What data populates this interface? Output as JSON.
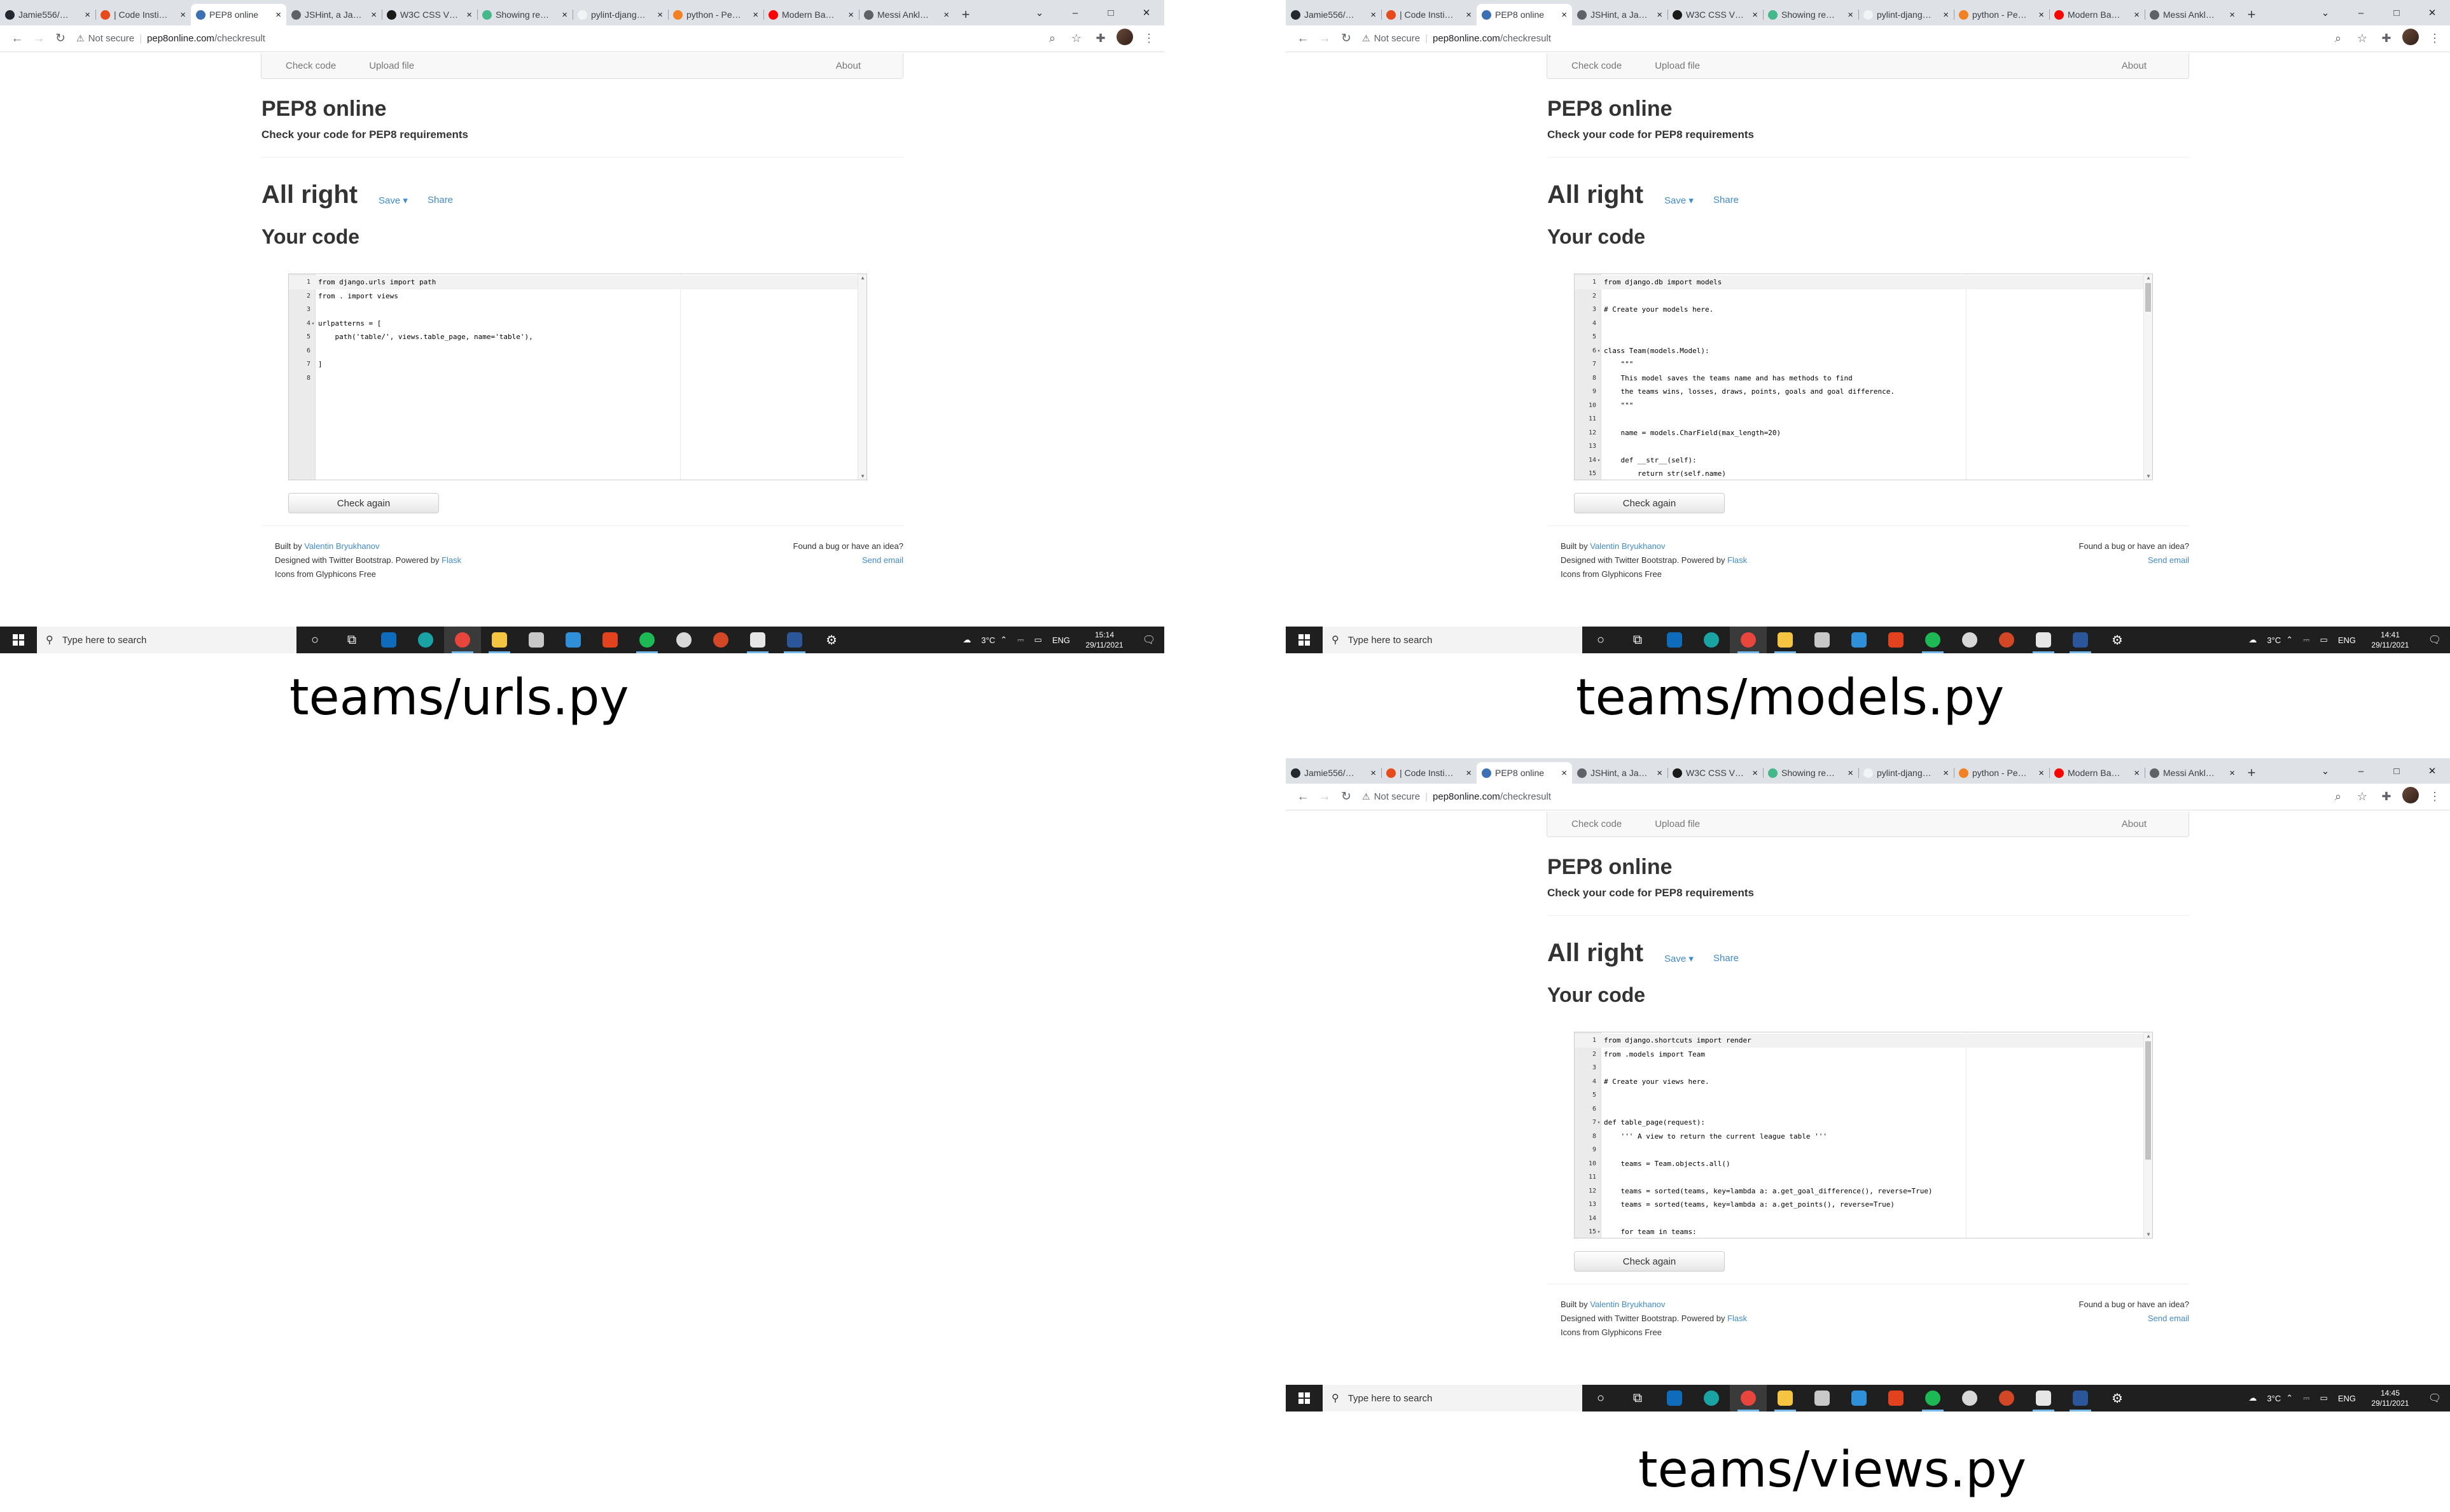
{
  "captions": [
    "teams/urls.py",
    "teams/models.py",
    "teams/views.py"
  ],
  "tabs": [
    {
      "title": "Jamie556/…",
      "icon": "github-icon",
      "color": "#24292f",
      "active": false
    },
    {
      "title": "| Code Insti…",
      "icon": "code-institute-icon",
      "color": "#e84a1c",
      "active": false
    },
    {
      "title": "PEP8 online",
      "icon": "pep8-icon",
      "color": "#3d6fb5",
      "active": true
    },
    {
      "title": "JSHint, a Ja…",
      "icon": "globe-icon",
      "color": "#5f6368",
      "active": false
    },
    {
      "title": "W3C CSS V…",
      "icon": "w3c-icon",
      "color": "#1a1a1a",
      "active": false
    },
    {
      "title": "Showing re…",
      "icon": "django-icon",
      "color": "#44b78b",
      "active": false
    },
    {
      "title": "pylint-djang…",
      "icon": "blank-page-icon",
      "color": "#f1f3f4",
      "active": false
    },
    {
      "title": "python - Pe…",
      "icon": "stackoverflow-icon",
      "color": "#f48024",
      "active": false
    },
    {
      "title": "Modern Ba…",
      "icon": "youtube-icon",
      "color": "#ff0000",
      "active": false
    },
    {
      "title": "Messi Ankl…",
      "icon": "globe-icon",
      "color": "#5f6368",
      "active": false
    }
  ],
  "window_controls": {
    "chevron": "⌄",
    "minimize": "–",
    "maximize": "□",
    "close": "✕"
  },
  "address": {
    "warning": "Not secure",
    "host": "pep8online.com",
    "path": "/checkresult"
  },
  "site": {
    "nav_check": "Check code",
    "nav_upload": "Upload file",
    "nav_about": "About",
    "title": "PEP8 online",
    "subtitle": "Check your code for PEP8 requirements",
    "result": "All right",
    "save": "Save ▾",
    "share": "Share",
    "your_code": "Your code",
    "check_again": "Check again",
    "footer": {
      "built_by": "Built by ",
      "author": "Valentin Bryukhanov",
      "designed": "Designed with Twitter Bootstrap. Powered by ",
      "flask": "Flask",
      "icons": "Icons from Glyphicons Free",
      "bug": "Found a bug or have an idea?",
      "send": "Send email"
    }
  },
  "shots": [
    {
      "time": "15:14",
      "date": "29/11/2021",
      "scroll_thumb_fraction": 0,
      "lines": [
        "from django.urls import path",
        "from . import views",
        "",
        "urlpatterns = [",
        "    path('table/', views.table_page, name='table'),",
        "",
        "]",
        ""
      ],
      "fold_lines": [
        4
      ]
    },
    {
      "time": "14:41",
      "date": "29/11/2021",
      "scroll_thumb_fraction": 0.15,
      "lines": [
        "from django.db import models",
        "",
        "# Create your models here.",
        "",
        "",
        "class Team(models.Model):",
        "    \"\"\"",
        "    This model saves the teams name and has methods to find",
        "    the teams wins, losses, draws, points, goals and goal difference.",
        "    \"\"\"",
        "",
        "    name = models.CharField(max_length=20)",
        "",
        "    def __str__(self):",
        "        return str(self.name)"
      ],
      "fold_lines": [
        6,
        14
      ]
    },
    {
      "time": "14:45",
      "date": "29/11/2021",
      "scroll_thumb_fraction": 0.62,
      "lines": [
        "from django.shortcuts import render",
        "from .models import Team",
        "",
        "# Create your views here.",
        "",
        "",
        "def table_page(request):",
        "    ''' A view to return the current league table '''",
        "",
        "    teams = Team.objects.all()",
        "",
        "    teams = sorted(teams, key=lambda a: a.get_goal_difference(), reverse=True)",
        "    teams = sorted(teams, key=lambda a: a.get_points(), reverse=True)",
        "",
        "    for team in teams:"
      ],
      "fold_lines": [
        7,
        15
      ]
    }
  ],
  "taskbar": {
    "search_placeholder": "Type here to search",
    "weather": "3°C",
    "lang": "ENG",
    "apps": [
      {
        "name": "cortana-icon",
        "glyph": "○",
        "color": ""
      },
      {
        "name": "task-view-icon",
        "glyph": "⧉",
        "color": ""
      },
      {
        "name": "mail-icon",
        "glyph": "",
        "color": "#0f6cbd"
      },
      {
        "name": "edge-icon",
        "glyph": "",
        "color": "#1aa3a3"
      },
      {
        "name": "chrome-icon",
        "glyph": "",
        "color": "#e8453c"
      },
      {
        "name": "file-explorer-icon",
        "glyph": "",
        "color": "#f5c542"
      },
      {
        "name": "calculator-icon",
        "glyph": "",
        "color": "#c8c8c8"
      },
      {
        "name": "internet-explorer-icon",
        "glyph": "",
        "color": "#2f8fd8"
      },
      {
        "name": "office-icon",
        "glyph": "",
        "color": "#e2431e"
      },
      {
        "name": "spotify-icon",
        "glyph": "",
        "color": "#1db954"
      },
      {
        "name": "chrome-canary-icon",
        "glyph": "",
        "color": "#d8d8d8"
      },
      {
        "name": "powerpoint-icon",
        "glyph": "",
        "color": "#d24726"
      },
      {
        "name": "paint-icon",
        "glyph": "",
        "color": "#e6e6e6"
      },
      {
        "name": "word-icon",
        "glyph": "",
        "color": "#2b579a"
      },
      {
        "name": "settings-icon",
        "glyph": "⚙",
        "color": ""
      }
    ]
  }
}
